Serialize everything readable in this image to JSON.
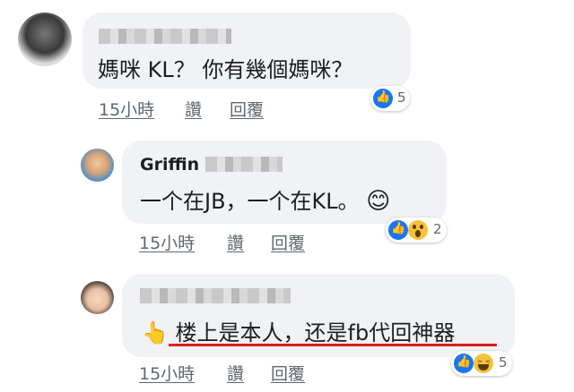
{
  "comments": [
    {
      "text": "媽咪 KL？ 你有幾個媽咪？",
      "time": "15小時",
      "like": "讚",
      "reply": "回覆",
      "reaction_count": "5",
      "reactions": [
        "like-icon"
      ]
    },
    {
      "name": "Griffin",
      "text": "一个在JB，一个在KL。",
      "emoji": "😊",
      "time": "15小時",
      "like": "讚",
      "reply": "回覆",
      "reaction_count": "2",
      "reactions": [
        "like-icon",
        "wow-icon"
      ]
    },
    {
      "pointer": "👆",
      "text": "楼上是本人，还是fb代回神器",
      "time": "15小時",
      "like": "讚",
      "reply": "回覆",
      "reaction_count": "5",
      "reactions": [
        "like-icon",
        "haha-icon"
      ]
    }
  ],
  "colors": {
    "bubble": "#f0f2f5",
    "like": "#1877f2",
    "underline": "#e01a1a"
  }
}
